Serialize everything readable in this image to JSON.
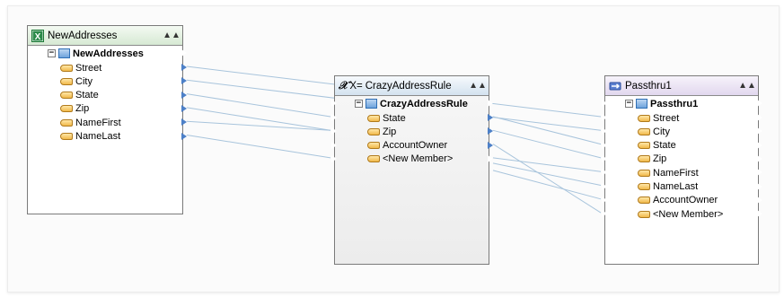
{
  "source": {
    "title": "NewAddresses",
    "icon": "excel-icon",
    "root": "NewAddresses",
    "fields": [
      "Street",
      "City",
      "State",
      "Zip",
      "NameFirst",
      "NameLast"
    ]
  },
  "transform": {
    "title": "CrazyAddressRule",
    "title_prefix": "X=",
    "icon": "formula-icon",
    "root": "CrazyAddressRule",
    "fields": [
      "State",
      "Zip",
      "AccountOwner",
      "<New Member>"
    ]
  },
  "target": {
    "title": "Passthru1",
    "icon": "passthru-icon",
    "root": "Passthru1",
    "fields": [
      "Street",
      "City",
      "State",
      "Zip",
      "NameFirst",
      "NameLast",
      "AccountOwner",
      "<New Member>"
    ]
  },
  "colors": {
    "wire": "#a8c4dc",
    "port": "#4d80c8"
  }
}
